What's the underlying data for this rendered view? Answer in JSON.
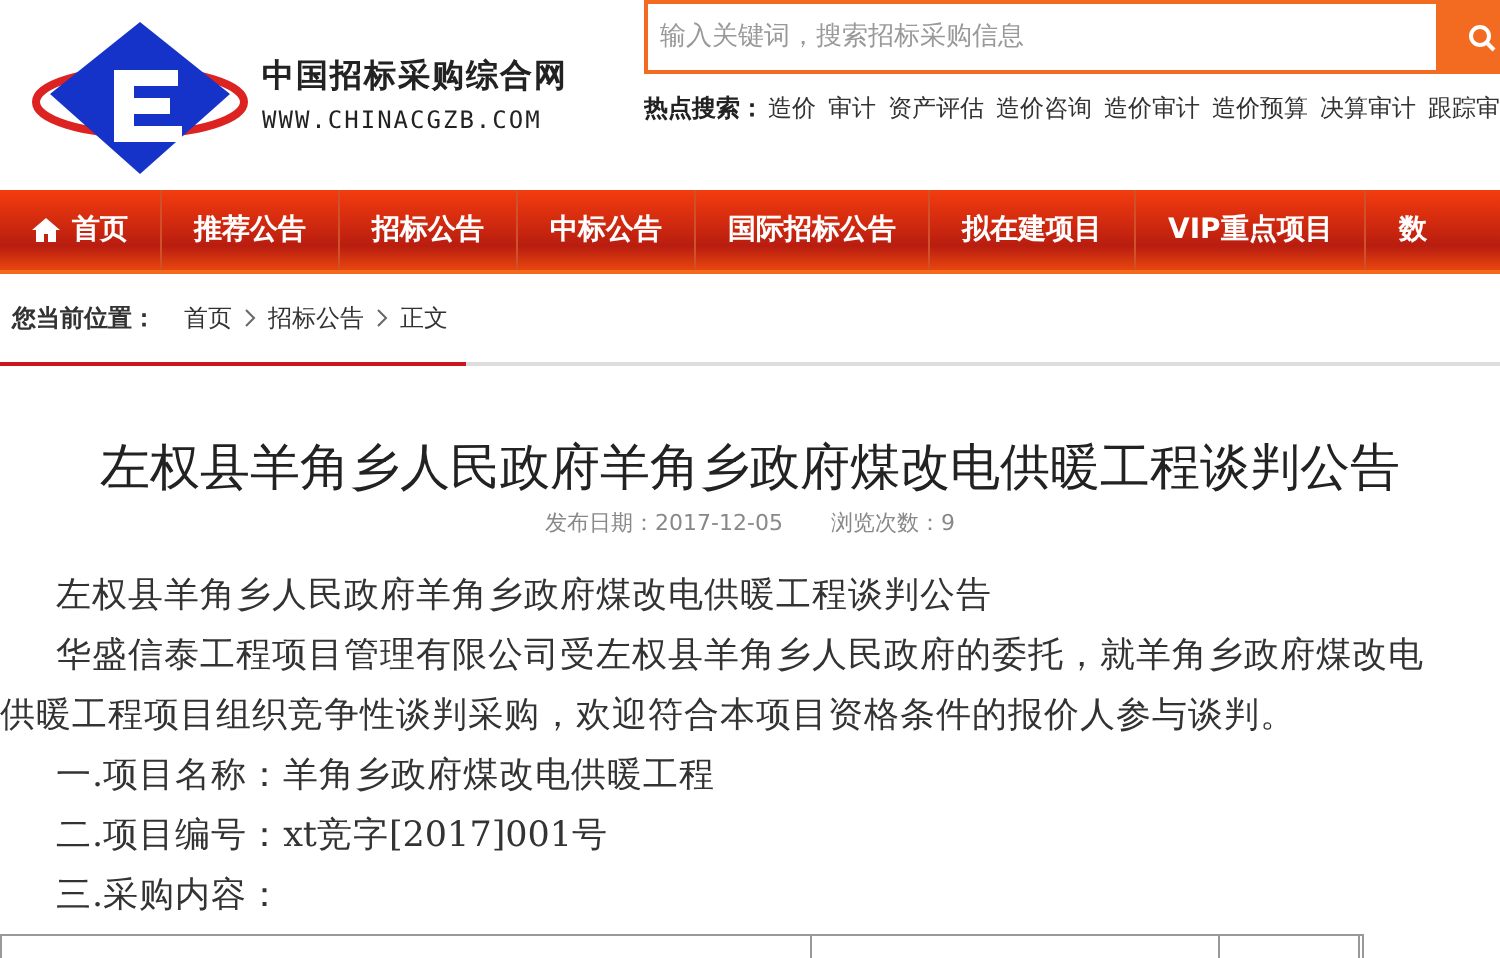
{
  "logo": {
    "name": "中国招标采购综合网",
    "url": "WWW.CHINACGZB.COM"
  },
  "search": {
    "placeholder": "输入关键词，搜索招标采购信息"
  },
  "hot_search": {
    "label": "热点搜索：",
    "terms": [
      "造价",
      "审计",
      "资产评估",
      "造价咨询",
      "造价审计",
      "造价预算",
      "决算审计",
      "跟踪审"
    ]
  },
  "nav": [
    {
      "label": "首页",
      "kind": "home"
    },
    {
      "label": "推荐公告",
      "kind": "link"
    },
    {
      "label": "招标公告",
      "kind": "link"
    },
    {
      "label": "中标公告",
      "kind": "link"
    },
    {
      "label": "国际招标公告",
      "kind": "link"
    },
    {
      "label": "拟在建项目",
      "kind": "link"
    },
    {
      "label": "VIP重点项目",
      "kind": "link"
    },
    {
      "label": "数",
      "kind": "link"
    }
  ],
  "breadcrumb": {
    "label": "您当前位置：",
    "items": [
      "首页",
      "招标公告",
      "正文"
    ]
  },
  "article": {
    "title": "左权县羊角乡人民政府羊角乡政府煤改电供暖工程谈判公告",
    "date": "发布日期：2017-12-05",
    "views": "浏览次数：9",
    "paragraphs": [
      "左权县羊角乡人民政府羊角乡政府煤改电供暖工程谈判公告",
      "华盛信泰工程项目管理有限公司受左权县羊角乡人民政府的委托，就羊角乡政府煤改电供暖工程项目组织竞争性谈判采购，欢迎符合本项目资格条件的报价人参与谈判。",
      "一.项目名称：羊角乡政府煤改电供暖工程",
      "二.项目编号：xt竞字[2017]001号",
      "三.采购内容："
    ]
  }
}
